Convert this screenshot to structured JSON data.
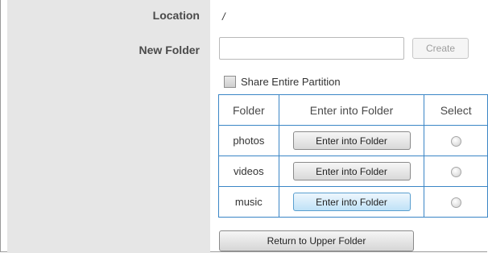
{
  "form": {
    "location_label": "Location",
    "location_value": "/",
    "new_folder_label": "New Folder",
    "new_folder_value": "",
    "create_button": "Create",
    "share_label": "Share Entire Partition",
    "share_checked": false
  },
  "table": {
    "headers": [
      "Folder",
      "Enter into Folder",
      "Select"
    ],
    "rows": [
      {
        "folder": "photos",
        "enter_label": "Enter into Folder",
        "selected": false
      },
      {
        "folder": "videos",
        "enter_label": "Enter into Folder",
        "selected": false
      },
      {
        "folder": "music",
        "enter_label": "Enter into Folder",
        "selected": false
      }
    ]
  },
  "return_button": "Return to Upper Folder",
  "colors": {
    "label_column_bg": "#e6e6e6",
    "table_border": "#3b86c6",
    "active_button": "#bfe2f7"
  }
}
